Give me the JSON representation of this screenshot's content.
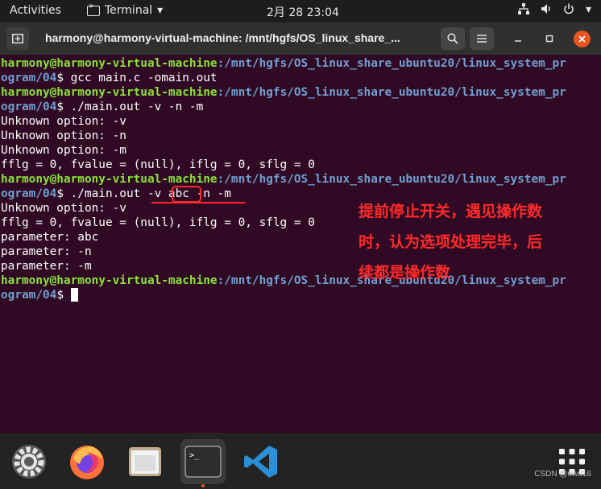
{
  "topbar": {
    "activities": "Activities",
    "app_name": "Terminal",
    "clock": "2月 28  23:04"
  },
  "window": {
    "title": "harmony@harmony-virtual-machine: /mnt/hgfs/OS_linux_share_..."
  },
  "terminal": {
    "prompt_user": "harmony@harmony-virtual-machine",
    "prompt_path_part1": ":/mnt/hgfs/OS_linux_share_ubuntu20/linux_system_pr",
    "prompt_path_part2": "ogram/04",
    "prompt_symbol": "$ ",
    "commands": {
      "c1": "gcc main.c -omain.out",
      "c2": "./main.out -v -n -m",
      "c3": "./main.out -v abc -n -m"
    },
    "output1": [
      "Unknown option: -v",
      "Unknown option: -n",
      "Unknown option: -m",
      "fflg = 0, fvalue = (null), iflg = 0, sflg = 0"
    ],
    "output2": [
      "Unknown option: -v",
      "fflg = 0, fvalue = (null), iflg = 0, sflg = 0",
      "parameter: abc",
      "parameter: -n",
      "parameter: -m"
    ]
  },
  "annotation": {
    "line1": "提前停止开关，遇见操作数",
    "line2": "时，认为选项处理完毕，后",
    "line3": "续都是操作数"
  },
  "dock": {
    "items": [
      "settings-icon",
      "firefox-icon",
      "files-icon",
      "terminal-icon",
      "vscode-icon",
      "app-grid-icon"
    ]
  },
  "watermark": "CSDN @uwu16",
  "colors": {
    "terminal_bg": "#300a24",
    "prompt_user": "#8ae234",
    "prompt_path": "#729fcf",
    "annotation": "#ff2a2a",
    "ubuntu_orange": "#e95420"
  }
}
